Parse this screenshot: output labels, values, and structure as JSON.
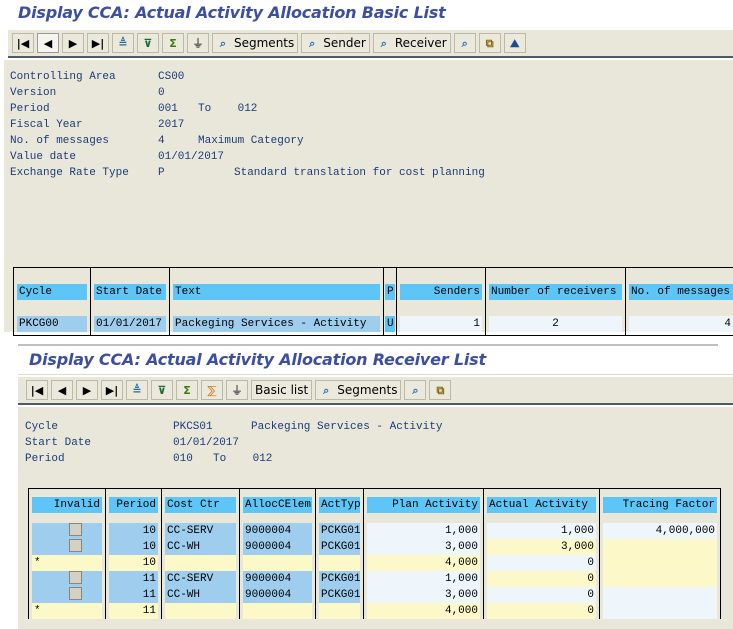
{
  "basic_list": {
    "title": "Display CCA: Actual Activity Allocation Basic List",
    "toolbar": [
      {
        "icon": "first-page-icon",
        "glyph": "⏮"
      },
      {
        "icon": "previous-page-icon",
        "glyph": "◀"
      },
      {
        "icon": "next-page-icon",
        "glyph": "▶"
      },
      {
        "icon": "last-page-icon",
        "glyph": "⏭"
      },
      {
        "icon": "sort-icon",
        "glyph": "⏏"
      },
      {
        "icon": "filter-icon",
        "glyph": "▼"
      },
      {
        "icon": "sum-icon",
        "glyph": "Σ"
      },
      {
        "icon": "set-filter-icon",
        "glyph": "⏚"
      }
    ],
    "segments_label": "Segments",
    "sender_label": "Sender",
    "receiver_label": "Receiver",
    "header": [
      {
        "label": "Controlling Area",
        "value": "CS00",
        "extra": ""
      },
      {
        "label": "Version",
        "value": "0",
        "extra": ""
      },
      {
        "label": "Period",
        "value": "001",
        "extra": "To    012"
      },
      {
        "label": "Fiscal Year",
        "value": "2017",
        "extra": ""
      },
      {
        "label": "No. of messages",
        "value": "4",
        "extra": "Maximum Category"
      },
      {
        "label": "Value date",
        "value": "01/01/2017",
        "extra": ""
      },
      {
        "label": "Exchange Rate Type",
        "value": "P",
        "extra": "Standard translation for cost planning"
      }
    ],
    "columns": [
      "Cycle",
      "Start Date",
      "Text",
      "P",
      "Senders",
      "Number of receivers",
      "No. of messages"
    ],
    "rows": [
      {
        "cycle": "PKCG00",
        "start_date": "01/01/2017",
        "text": "Packeging Services - Activity",
        "p": "U",
        "senders": "1",
        "receivers": "2",
        "messages": "4"
      }
    ]
  },
  "receiver_list": {
    "title": "Display CCA: Actual Activity Allocation Receiver List",
    "basic_list_label": "Basic list",
    "segments_label": "Segments",
    "header": [
      {
        "label": "Cycle",
        "value": "PKCS01",
        "extra": "Packeging Services - Activity"
      },
      {
        "label": "Start Date",
        "value": "01/01/2017",
        "extra": ""
      },
      {
        "label": "Period",
        "value": "010",
        "extra": "To    012"
      }
    ],
    "columns": [
      "Invalid",
      "Period",
      "Cost Ctr",
      "AllocCElem",
      "ActTyp",
      "Plan Activity",
      "Actual Activity",
      "Tracing Factor"
    ],
    "rows": [
      {
        "type": "item",
        "invalid": "",
        "period": "10",
        "cost_ctr": "CC-SERV",
        "alloc": "9000004",
        "acttyp": "PCKG01",
        "plan": "1,000",
        "actual": "1,000",
        "tracing": "4,000,000"
      },
      {
        "type": "item",
        "invalid": "",
        "period": "10",
        "cost_ctr": "CC-WH",
        "alloc": "9000004",
        "acttyp": "PCKG01",
        "plan": "3,000",
        "actual": "3,000",
        "tracing": ""
      },
      {
        "type": "subtotal",
        "invalid": "*",
        "period": "10",
        "cost_ctr": "",
        "alloc": "",
        "acttyp": "",
        "plan": "4,000",
        "actual": "0",
        "tracing": ""
      },
      {
        "type": "item",
        "invalid": "",
        "period": "11",
        "cost_ctr": "CC-SERV",
        "alloc": "9000004",
        "acttyp": "PCKG01",
        "plan": "1,000",
        "actual": "0",
        "tracing": ""
      },
      {
        "type": "item",
        "invalid": "",
        "period": "11",
        "cost_ctr": "CC-WH",
        "alloc": "9000004",
        "acttyp": "PCKG01",
        "plan": "3,000",
        "actual": "0",
        "tracing": ""
      },
      {
        "type": "subtotal",
        "invalid": "*",
        "period": "11",
        "cost_ctr": "",
        "alloc": "",
        "acttyp": "",
        "plan": "4,000",
        "actual": "0",
        "tracing": ""
      }
    ]
  },
  "colors": {
    "title": "#3d4fa0",
    "header_cell": "#5ec6f6",
    "key_cell": "#9ecdee",
    "value_cell": "#eef6fb",
    "subtotal": "#fcf8c8",
    "panel": "#e9e7d9"
  }
}
